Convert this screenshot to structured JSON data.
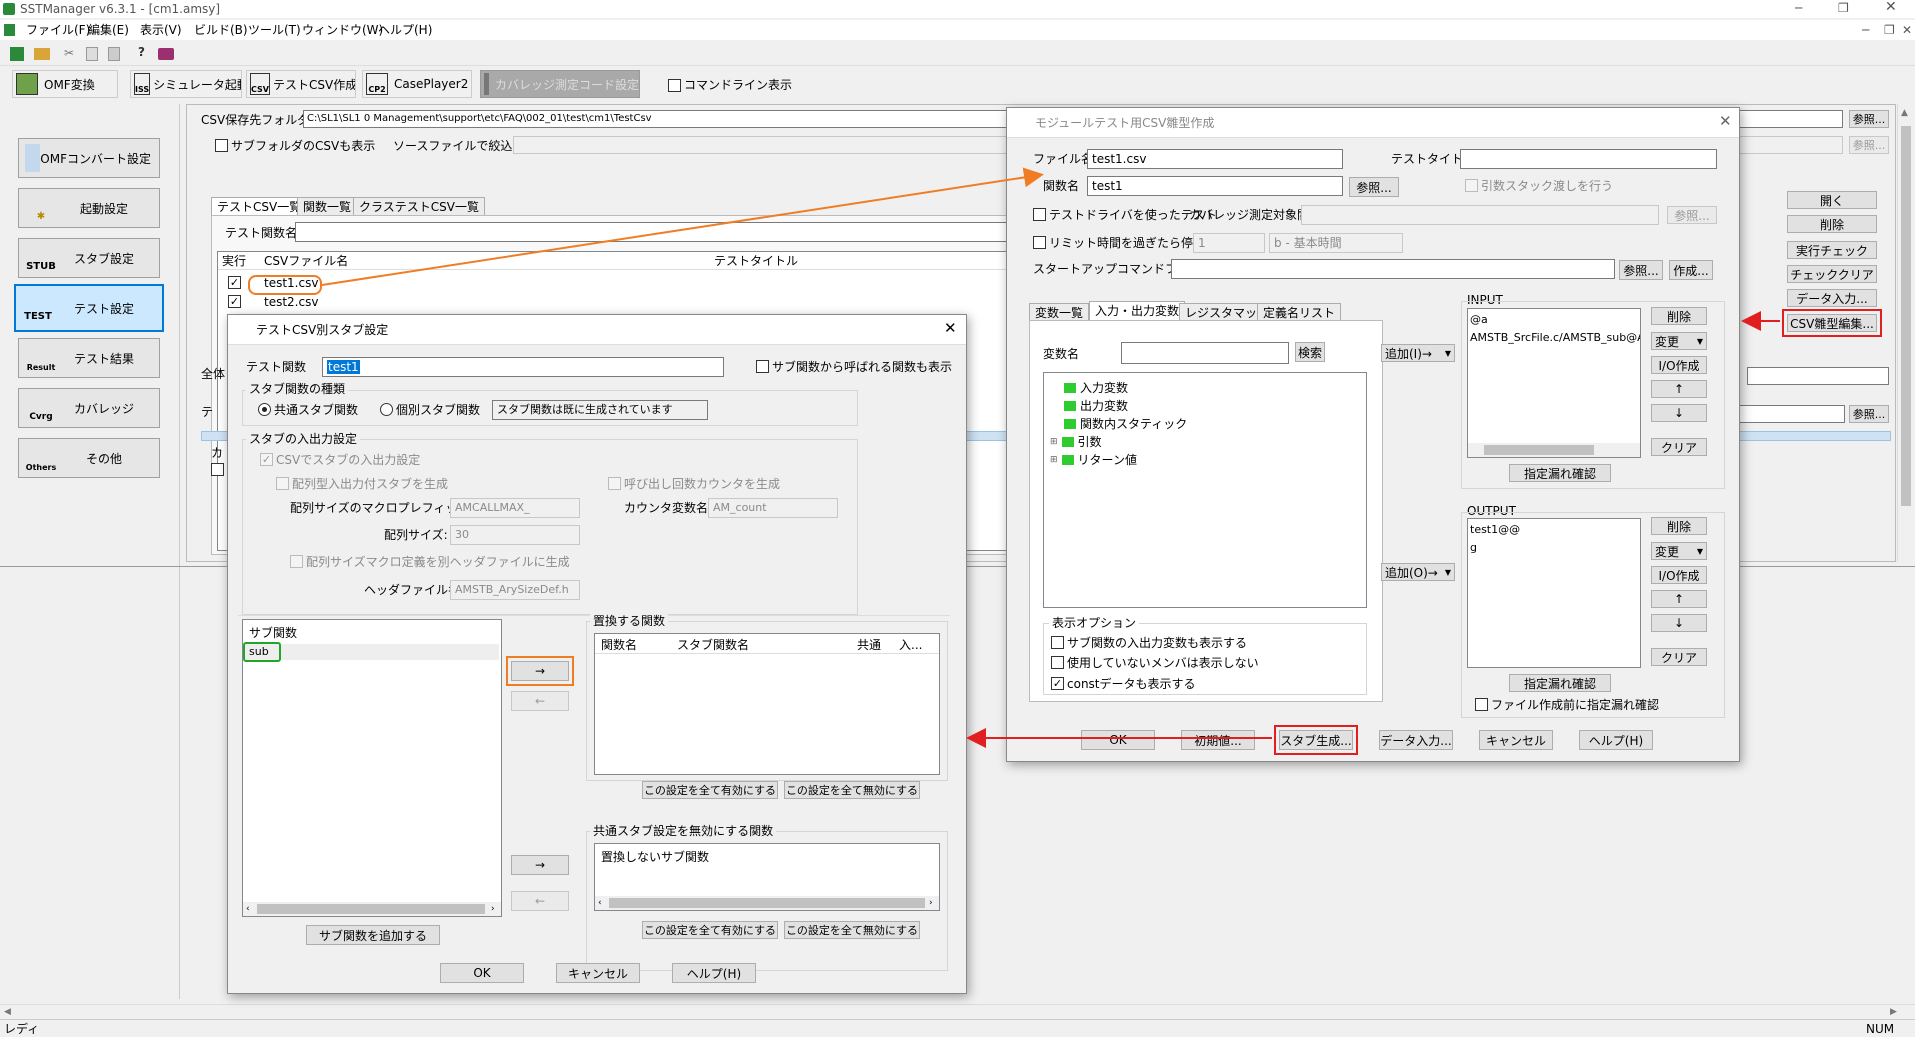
{
  "app": {
    "title": "SSTManager v6.3.1 - [cm1.amsy]",
    "status": "レディ",
    "num": "NUM"
  },
  "menu": [
    "ファイル(F)",
    "編集(E)",
    "表示(V)",
    "ビルド(B)",
    "ツール(T)",
    "ウィンドウ(W)",
    "ヘルプ(H)"
  ],
  "toolbar2": {
    "omf": "OMF変換",
    "sim": "シミュレータ起動",
    "testcsv": "テストCSV作成",
    "caseplayer": "CasePlayer2",
    "coverage": "カバレッジ測定コード設定",
    "cmdline": "コマンドライン表示"
  },
  "sidebar": [
    {
      "label": "OMFコンバート設定",
      "icon": ""
    },
    {
      "label": "起動設定",
      "icon": ""
    },
    {
      "label": "スタブ設定",
      "icon": "STUB"
    },
    {
      "label": "テスト設定",
      "icon": "TEST"
    },
    {
      "label": "テスト結果",
      "icon": "Result"
    },
    {
      "label": "カバレッジ",
      "icon": "Cvrg"
    },
    {
      "label": "その他",
      "icon": "Others"
    }
  ],
  "main": {
    "csv_folder_label": "CSV保存先フォルダ:",
    "csv_folder_value": "C:\\SL1\\SL1 0 Management\\support\\etc\\FAQ\\002_01\\test\\cm1\\TestCsv",
    "ref": "参照...",
    "subfolder": "サブフォルダのCSVも表示",
    "source_filter": "ソースファイルで絞込み:",
    "tabs": [
      "テストCSV一覧",
      "関数一覧",
      "クラステストCSV一覧"
    ],
    "test_func_label": "テスト関数名",
    "cols": [
      "実行",
      "CSVファイル名",
      "テストタイトル"
    ],
    "rows": [
      "test1.csv",
      "test2.csv"
    ],
    "whole": "全体",
    "te": "テ",
    "ka": "カ",
    "right_buttons": [
      "開く",
      "削除",
      "実行チェック",
      "チェッククリア",
      "データ入力...",
      "CSV雛型編集..."
    ]
  },
  "mod": {
    "title": "モジュールテスト用CSV雛型作成",
    "file_label": "ファイル名",
    "file_value": "test1.csv",
    "func_label": "関数名",
    "func_value": "test1",
    "title_label": "テストタイトル",
    "argstack": "引数スタック渡しを行う",
    "testdriver": "テストドライバを使ったテスト",
    "covfunc": "カバレッジ測定対象関数",
    "limit": "リミット時間を過ぎたら停止",
    "limit_val": "1",
    "limit_unit": "b - 基本時間",
    "startup": "スタートアップコマンドファイル:",
    "create": "作成...",
    "tabs": [
      "変数一覧",
      "入力・出力変数",
      "レジスタマップ",
      "定義名リスト"
    ],
    "var_label": "変数名",
    "search": "検索",
    "tree": [
      "入力変数",
      "出力変数",
      "関数内スタティック",
      "引数",
      "リターン値"
    ],
    "add_in": "追加(I)→",
    "add_out": "追加(O)→",
    "display_opt": "表示オプション",
    "opts": [
      "サブ関数の入出力変数も表示する",
      "使用していないメンバは表示しない",
      "constデータも表示する"
    ],
    "input_label": "INPUT",
    "input_items": [
      "@a",
      "AMSTB_SrcFile.c/AMSTB_sub@A"
    ],
    "output_label": "OUTPUT",
    "output_items": [
      "test1@@",
      "g"
    ],
    "side_btns": [
      "削除",
      "変更",
      "I/O作成",
      "↑",
      "↓",
      "クリア"
    ],
    "check": "指定漏れ確認",
    "check_before": "ファイル作成前に指定漏れ確認",
    "bottom": [
      "OK",
      "初期値...",
      "スタブ生成...",
      "データ入力...",
      "キャンセル",
      "ヘルプ(H)"
    ]
  },
  "stub": {
    "title": "テストCSV別スタブ設定",
    "func_label": "テスト関数",
    "func_value": "test1",
    "show_sub": "サブ関数から呼ばれる関数も表示",
    "kind_label": "スタブ関数の種類",
    "common": "共通スタブ関数",
    "individual": "個別スタブ関数",
    "status": "スタブ関数は既に生成されています",
    "io_label": "スタブの入出力設定",
    "csv_io": "CSVでスタブの入出力設定",
    "array_io": "配列型入出力付スタブを生成",
    "call_counter": "呼び出し回数カウンタを生成",
    "macro_prefix_label": "配列サイズのマクロプレフィックス:",
    "macro_prefix": "AMCALLMAX_",
    "counter_label": "カウンタ変数名:",
    "counter": "AM_count",
    "array_size_label": "配列サイズ:",
    "array_size": "30",
    "header_macro": "配列サイズマクロ定義を別ヘッダファイルに生成",
    "header_label": "ヘッダファイル名:",
    "header": "AMSTB_ArySizeDef.h",
    "sub_header": "サブ関数",
    "sub_items": [
      "sub"
    ],
    "replace_label": "置換する関数",
    "replace_cols": [
      "関数名",
      "スタブ関数名",
      "共通",
      "入..."
    ],
    "enable_all": "この設定を全て有効にする",
    "disable_all": "この設定を全て無効にする",
    "disable_label": "共通スタブ設定を無効にする関数",
    "no_replace": "置換しないサブ関数",
    "add_sub": "サブ関数を追加する",
    "ok": "OK",
    "cancel": "キャンセル",
    "help": "ヘルプ(H)",
    "right": "→",
    "left": "←"
  }
}
